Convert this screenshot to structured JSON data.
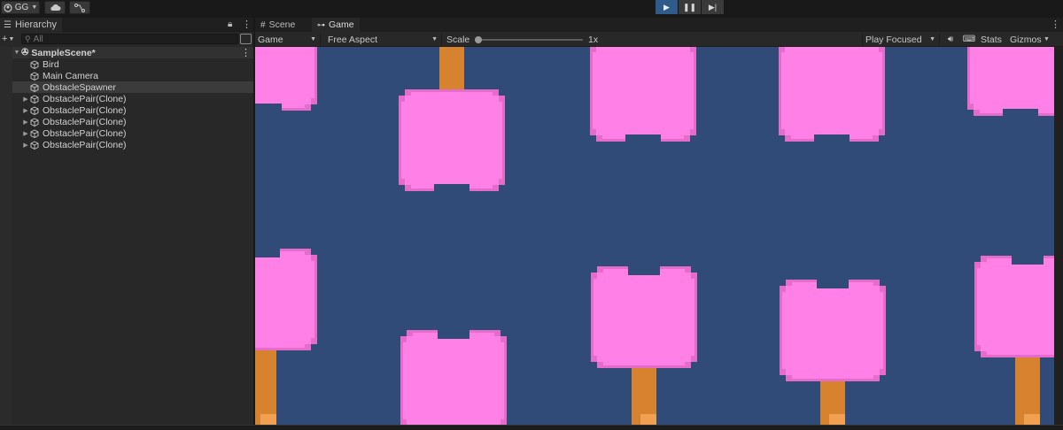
{
  "toolbar": {
    "account_label": "GG",
    "icons": [
      "account-icon",
      "cloud-icon",
      "version-control-icon"
    ],
    "play_controls": [
      "play-icon",
      "pause-icon",
      "step-icon"
    ],
    "play_active": true
  },
  "hierarchy": {
    "tab_label": "Hierarchy",
    "search_placeholder": "All",
    "scene_name": "SampleScene*",
    "items": [
      {
        "label": "Bird",
        "foldout": false,
        "selected": false
      },
      {
        "label": "Main Camera",
        "foldout": false,
        "selected": false
      },
      {
        "label": "ObstacleSpawner",
        "foldout": false,
        "selected": true
      },
      {
        "label": "ObstaclePair(Clone)",
        "foldout": true,
        "selected": false
      },
      {
        "label": "ObstaclePair(Clone)",
        "foldout": true,
        "selected": false
      },
      {
        "label": "ObstaclePair(Clone)",
        "foldout": true,
        "selected": false
      },
      {
        "label": "ObstaclePair(Clone)",
        "foldout": true,
        "selected": false
      },
      {
        "label": "ObstaclePair(Clone)",
        "foldout": true,
        "selected": false
      }
    ]
  },
  "game_view": {
    "tabs": [
      {
        "label": "Scene",
        "icon": "grid-icon",
        "active": false
      },
      {
        "label": "Game",
        "icon": "gamepad-icon",
        "active": true
      }
    ],
    "display_dropdown": "Game",
    "aspect_dropdown": "Free Aspect",
    "scale_label": "Scale",
    "scale_value": "1x",
    "play_mode_dropdown": "Play Focused",
    "stats_label": "Stats",
    "gizmos_label": "Gizmos",
    "colors": {
      "background": "#304b77",
      "foliage": "#ff80e6",
      "foliage_shade": "#e66ccc",
      "trunk": "#d6822e",
      "trunk_light": "#f0a050",
      "play_active": "#2e5b8a"
    }
  }
}
